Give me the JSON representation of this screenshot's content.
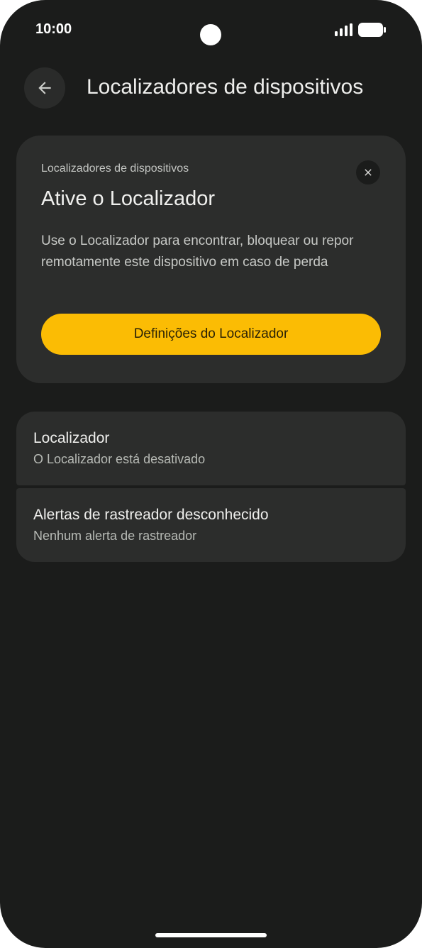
{
  "status_bar": {
    "time": "10:00",
    "icons": [
      "cell-signal-icon",
      "battery-icon"
    ]
  },
  "app_bar": {
    "back_icon": "arrow-left-icon",
    "title": "Localizadores de dispositivos"
  },
  "banner": {
    "eyebrow": "Localizadores de dispositivos",
    "title": "Ative o Localizador",
    "body": "Use o Localizador para encontrar, bloquear ou repor remotamente este dispositivo em caso de perda",
    "action_label": "Definições do Localizador",
    "close_icon": "close-icon",
    "accent_color": "#fbbc04"
  },
  "list": {
    "items": [
      {
        "title": "Localizador",
        "subtitle": "O Localizador está desativado"
      },
      {
        "title": "Alertas de rastreador desconhecido",
        "subtitle": "Nenhum alerta de rastreador"
      }
    ]
  }
}
